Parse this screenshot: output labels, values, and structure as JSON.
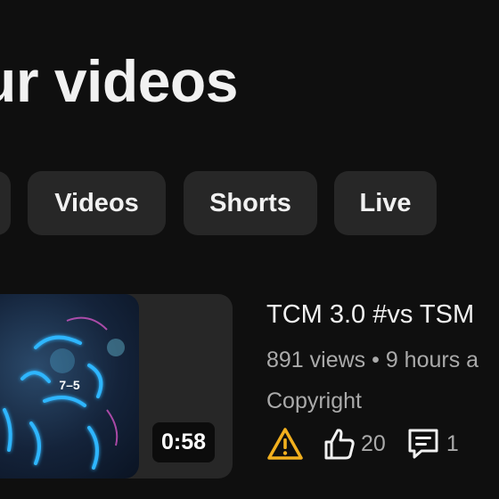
{
  "page": {
    "title": "ur videos"
  },
  "filters": {
    "chips": [
      {
        "label": "Videos"
      },
      {
        "label": "Shorts"
      },
      {
        "label": "Live"
      }
    ]
  },
  "video": {
    "thumbnail_text": "7–5",
    "duration": "0:58",
    "title": "TCM 3.0 #vs TSM",
    "meta": "891 views • 9 hours a",
    "license": "Copyright",
    "likes": "20",
    "comments": "1",
    "warning_color": "#f2b01e",
    "icons": [
      "warning-icon",
      "thumbs-up-icon",
      "comment-icon"
    ]
  }
}
